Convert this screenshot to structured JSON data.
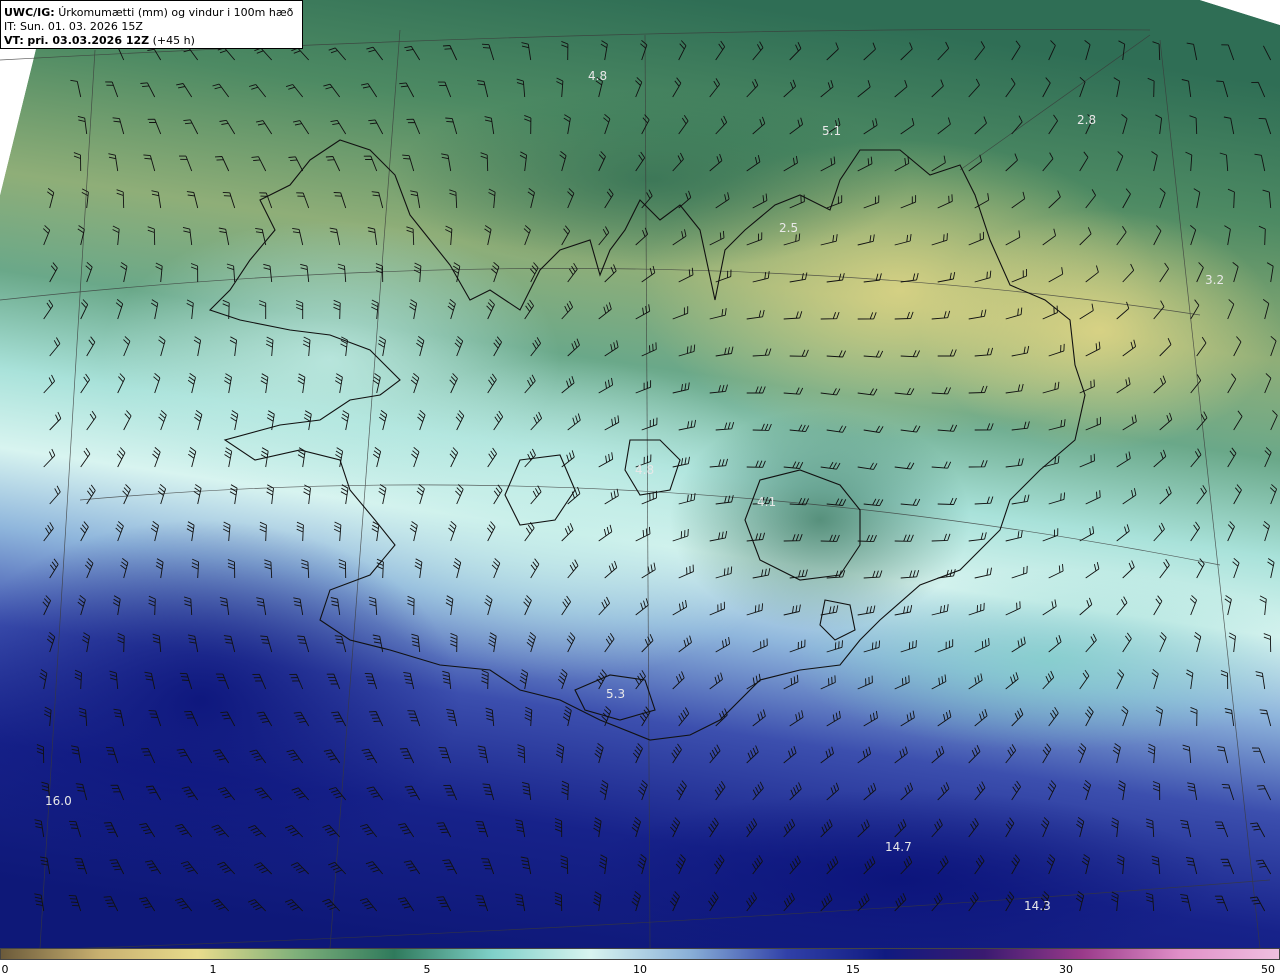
{
  "header": {
    "model": "UWC/IG:",
    "product": "Úrkomumætti (mm) og vindur i 100m hæð",
    "init_time": "IT: Sun. 01. 03. 2026 15Z",
    "valid_label": "VT:",
    "valid_time": "pri. 03.03.2026 12Z",
    "lead_time": "(+45 h)"
  },
  "value_labels": [
    {
      "id": "v1",
      "text": "4.8"
    },
    {
      "id": "v2",
      "text": "5.1"
    },
    {
      "id": "v3",
      "text": "2.8"
    },
    {
      "id": "v4",
      "text": "2.5"
    },
    {
      "id": "v5",
      "text": "3.2"
    },
    {
      "id": "v6",
      "text": "4.8"
    },
    {
      "id": "v7",
      "text": "4.1"
    },
    {
      "id": "v8",
      "text": "5.3"
    },
    {
      "id": "v9",
      "text": "16.0"
    },
    {
      "id": "v10",
      "text": "14.7"
    },
    {
      "id": "v11",
      "text": "14.3"
    }
  ],
  "colorbar": {
    "ticks": [
      "0",
      "1",
      "5",
      "10",
      "15",
      "30",
      "50"
    ],
    "colors": [
      "#6b5a3a",
      "#c8b070",
      "#e8dc8c",
      "#7fb07a",
      "#2f7a5c",
      "#7fd0c8",
      "#d8f4f0",
      "#8ab0d8",
      "#3040a8",
      "#101a80",
      "#3a1a70",
      "#9a3a8a",
      "#e090c8",
      "#f0c0e0"
    ]
  }
}
